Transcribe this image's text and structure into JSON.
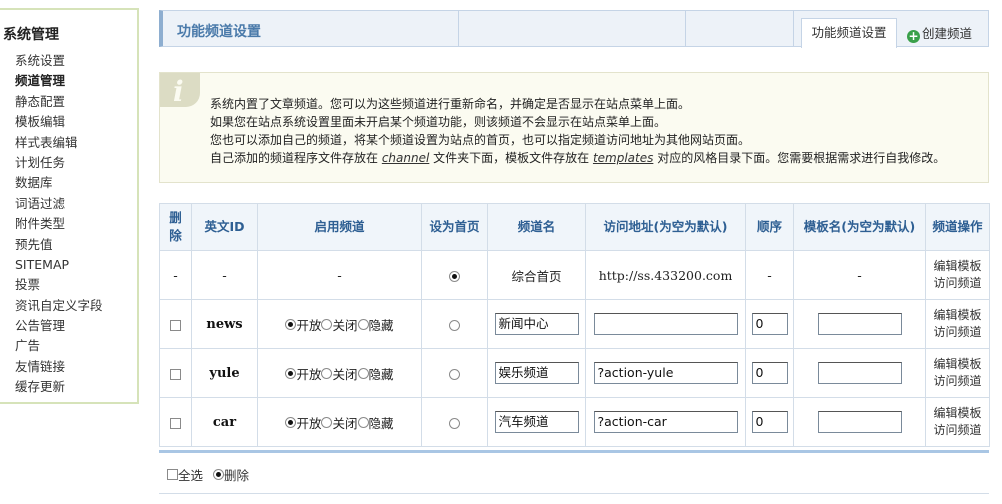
{
  "sidebar": {
    "title": "系统管理",
    "items": [
      "系统设置",
      "频道管理",
      "静态配置",
      "模板编辑",
      "样式表编辑",
      "计划任务",
      "数据库",
      "词语过滤",
      "附件类型",
      "预先值",
      "SITEMAP",
      "投票",
      "资讯自定义字段",
      "公告管理",
      "广告",
      "友情链接",
      "缓存更新"
    ],
    "active_index": 1
  },
  "header": {
    "title": "功能频道设置",
    "tab_active": "功能频道设置",
    "tab_create": "创建频道",
    "plus_icon": "+"
  },
  "notice": {
    "icon": "i",
    "line1": "系统内置了文章频道。您可以为这些频道进行重新命名，并确定是否显示在站点菜单上面。",
    "line2": "如果您在站点系统设置里面未开启某个频道功能，则该频道不会显示在站点菜单上面。",
    "line3": "您也可以添加自己的频道，将某个频道设置为站点的首页，也可以指定频道访问地址为其他网站页面。",
    "line4_a": "自己添加的频道程序文件存放在 ",
    "line4_b": "channel",
    "line4_c": " 文件夹下面，模板文件存放在 ",
    "line4_d": "templates",
    "line4_e": " 对应的风格目录下面。您需要根据需求进行自我修改。"
  },
  "table": {
    "headers": {
      "del": "删除",
      "en_id": "英文ID",
      "enable": "启用频道",
      "home": "设为首页",
      "name": "频道名",
      "url": "访问地址(为空为默认)",
      "order": "顺序",
      "tpl": "模板名(为空为默认)",
      "ops": "频道操作"
    },
    "opt_labels": {
      "open": "开放",
      "close": "关闭",
      "hide": "隐藏"
    },
    "op_labels": {
      "edit": "编辑模板",
      "visit": "访问频道"
    },
    "home_row": {
      "del": "-",
      "en_id": "-",
      "enable": "-",
      "name": "综合首页",
      "url": "http://ss.433200.com",
      "order": "-",
      "tpl": "-"
    },
    "rows": [
      {
        "en_id": "news",
        "name": "新闻中心",
        "url": "",
        "order": "0",
        "tpl": ""
      },
      {
        "en_id": "yule",
        "name": "娱乐频道",
        "url": "?action-yule",
        "order": "0",
        "tpl": ""
      },
      {
        "en_id": "car",
        "name": "汽车频道",
        "url": "?action-car",
        "order": "0",
        "tpl": ""
      }
    ]
  },
  "footer": {
    "select_all": "全选",
    "delete": "删除"
  }
}
